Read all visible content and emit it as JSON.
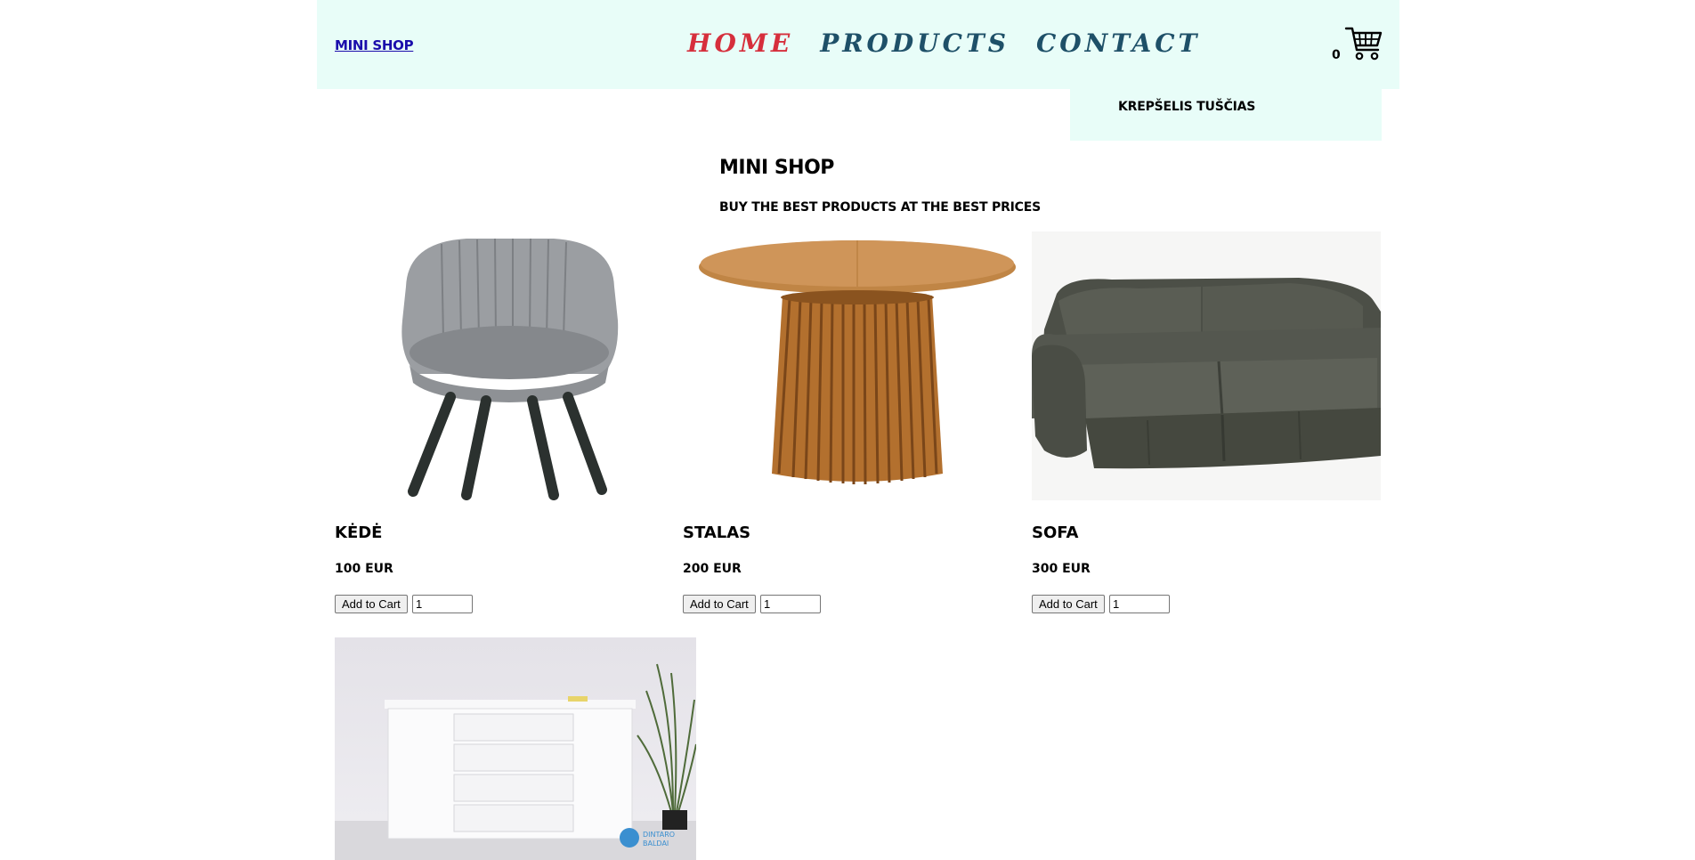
{
  "header": {
    "logo": "MINI SHOP",
    "nav": [
      {
        "label": "HOME",
        "active": true
      },
      {
        "label": "PRODUCTS",
        "active": false
      },
      {
        "label": "CONTACT",
        "active": false
      }
    ],
    "cart_count": "0",
    "cart_icon": "shopping-cart-icon"
  },
  "cart_dropdown": {
    "empty_text": "KREPŠELIS TUŠČIAS"
  },
  "hero": {
    "title": "MINI SHOP",
    "subtitle": "BUY THE BEST PRODUCTS AT THE BEST PRICES"
  },
  "products": [
    {
      "name": "KĖDĖ",
      "price": "100 EUR",
      "button": "Add to Cart",
      "qty": "1",
      "image": "chair-image"
    },
    {
      "name": "STALAS",
      "price": "200 EUR",
      "button": "Add to Cart",
      "qty": "1",
      "image": "table-image"
    },
    {
      "name": "SOFA",
      "price": "300 EUR",
      "button": "Add to Cart",
      "qty": "1",
      "image": "sofa-image"
    },
    {
      "name": "",
      "price": "",
      "button": "",
      "qty": "",
      "image": "sideboard-image"
    }
  ],
  "colors": {
    "header_bg": "#e8fdf8",
    "nav_active": "#d62f3c",
    "nav_inactive": "#1e5068"
  }
}
